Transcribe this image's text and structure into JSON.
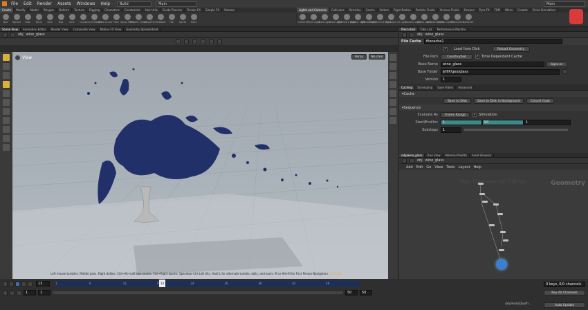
{
  "menu": {
    "items": [
      "File",
      "Edit",
      "Render",
      "Assets",
      "Windows",
      "Help"
    ],
    "desktop": "Build",
    "context": "Main",
    "right_context": "Main"
  },
  "shelf_left": {
    "tabs": [
      "Create",
      "Modify",
      "Model",
      "Polygon",
      "Deform",
      "Texture",
      "Rigging",
      "Characters",
      "Constraints",
      "Hair Utils",
      "Guide Process",
      "Terrain FX",
      "Simple FX",
      "Volume"
    ],
    "tools": [
      "Box",
      "Sphere",
      "Tube",
      "Torus",
      "Grid",
      "Null",
      "Line",
      "Circle",
      "Curve Bezier",
      "Draw Curve",
      "Path",
      "Spray Paint",
      "Platonic Solids",
      "L-System",
      "Metaball",
      "File",
      "Spiral",
      "Helix"
    ]
  },
  "shelf_right": {
    "tabs": [
      "Lights and Cameras",
      "Collisions",
      "Particles",
      "Grains",
      "Vellum",
      "Rigid Bodies",
      "Particle Fluids",
      "Viscous Fluids",
      "Oceans",
      "Pyro FX",
      "FEM",
      "Wires",
      "Crowds",
      "Drive Simulation"
    ],
    "tools": [
      "Camera",
      "Point Light",
      "Spot Light",
      "Area Light",
      "Geometry Light",
      "Volume Light",
      "Distant Light",
      "Environment Light",
      "Sky Light",
      "GI Light",
      "Caustic Light",
      "Portal Light",
      "Ambient Light",
      "Stereo Camera",
      "VR Camera",
      "Switcher"
    ]
  },
  "left_panes": {
    "tabs": [
      "Scene View",
      "Animation Editor",
      "Render View",
      "Composite View",
      "Motion FX View",
      "Geometry Spreadsheet"
    ],
    "path": [
      "obj",
      "wine_glass"
    ]
  },
  "viewport": {
    "label": "View",
    "persp": "Persp",
    "cam": "No cam",
    "hint": "Left mouse tumbles. Middle pans. Right dollies. Ctrl+Alt+Left box-zooms. Ctrl+Right zooms. Spacebar-Ctrl-Left tilts. Hold L for alternate tumble, dolly, and zoom. M or Alt+M for First Person Navigation.",
    "hint_key": "Ctrl+Left"
  },
  "timeline": {
    "current_frame": "13",
    "frame_marker": "13",
    "start": "1",
    "start2": "1",
    "end": "50",
    "end2": "50",
    "ticks": [
      "1",
      "6",
      "12",
      "18",
      "24",
      "30",
      "36",
      "42",
      "48"
    ]
  },
  "status": {
    "keys": "0 keys, 0/0 channels",
    "channels": "Key All Channels",
    "path": "/obj/AutoDopth...",
    "update": "Auto Update"
  },
  "params_panel": {
    "tabs": [
      "filecache2",
      "Take List",
      "Performance Monitor"
    ],
    "path": [
      "obj",
      "wine_glass"
    ],
    "node_type": "File Cache",
    "node_name": "filecache2",
    "load_from_disk": "Load from Disk",
    "reload": "Reload Geometry",
    "file_path_label": "File Path",
    "file_path_mode": "Constructed",
    "time_dependent": "Time Dependent Cache",
    "base_name_label": "Base Name",
    "base_name": "wine_glass",
    "ext": "bgeo.sc",
    "base_folder_label": "Base Folder",
    "base_folder": "$HIP/geo/glass",
    "version_label": "Version",
    "version": "1",
    "subtabs": [
      "Caching",
      "Scheduling",
      "Save Filters",
      "Advanced"
    ],
    "cache_section": "Cache",
    "save_disk": "Save to Disk",
    "save_bg": "Save to Disk in Background",
    "cancel": "Cancel Cook",
    "sequence_section": "Sequence",
    "evaluate_label": "Evaluate As",
    "evaluate": "Frame Range",
    "simulation": "Simulation",
    "range_label": "Start/End/Inc",
    "range_start": "1",
    "range_end": "50",
    "range_inc": "1",
    "substeps_label": "Substeps",
    "substeps": "1"
  },
  "network": {
    "tabs": [
      "/obj/wine_glass",
      "Tree View",
      "Material Palette",
      "Asset Browser"
    ],
    "path": [
      "obj",
      "wine_glass"
    ],
    "menu": [
      "Add",
      "Edit",
      "Go",
      "View",
      "Tools",
      "Layout",
      "Help"
    ],
    "watermark": "Non-Commercial Edition",
    "context_label": "Geometry"
  }
}
